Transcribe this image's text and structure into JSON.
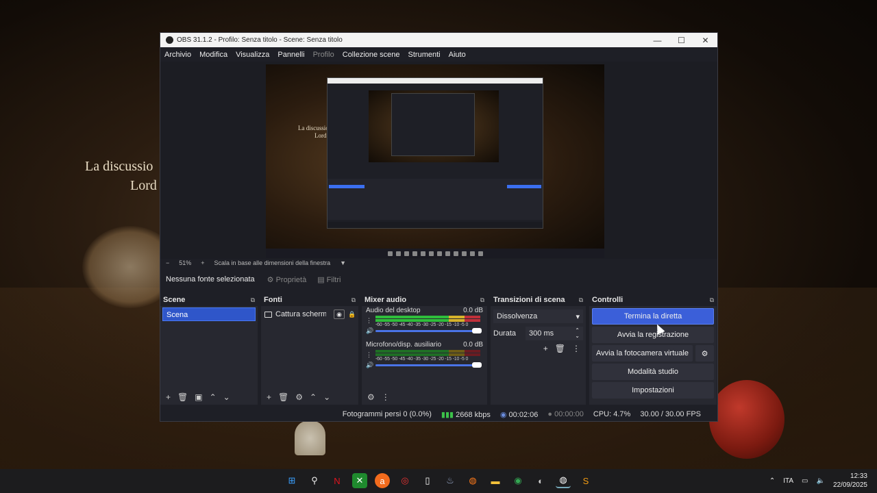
{
  "desktop": {
    "bg_text_line1": "La discussio",
    "bg_text_line2": "Lord"
  },
  "window": {
    "title": "OBS 31.1.2 - Profilo: Senza titolo - Scene: Senza titolo",
    "controls": {
      "minimize": "—",
      "maximize": "☐",
      "close": "✕"
    }
  },
  "menu": {
    "items": [
      "Archivio",
      "Modifica",
      "Visualizza",
      "Pannelli",
      "Profilo",
      "Collezione scene",
      "Strumenti",
      "Aiuto"
    ],
    "disabled_item": "Profilo"
  },
  "preview": {
    "text_line1": "La discussio",
    "text_line2": "Lord"
  },
  "zoombar": {
    "minus": "−",
    "zoom": "51%",
    "plus": "+",
    "mode": "Scala in base alle dimensioni della finestra",
    "dropdown": "▼"
  },
  "sourcebar": {
    "no_selection": "Nessuna fonte selezionata",
    "properties": "Proprietà",
    "filters": "Filtri"
  },
  "scenes": {
    "title": "Scene",
    "items": [
      "Scena"
    ]
  },
  "sources": {
    "title": "Fonti",
    "items": [
      "Cattura schermo"
    ]
  },
  "mixer": {
    "title": "Mixer audio",
    "scale": "-60 -55 -50 -45 -40 -35 -30 -25 -20 -15 -10 -5 0",
    "channels": [
      {
        "name": "Audio del desktop",
        "db": "0.0 dB"
      },
      {
        "name": "Microfono/disp. ausiliario",
        "db": "0.0 dB"
      }
    ]
  },
  "transitions": {
    "title": "Transizioni di scena",
    "selected": "Dissolvenza",
    "duration_label": "Durata",
    "duration_value": "300 ms"
  },
  "controls": {
    "title": "Controlli",
    "stop_stream": "Termina la diretta",
    "start_recording": "Avvia la registrazione",
    "start_virtualcam": "Avvia la fotocamera virtuale",
    "studio_mode": "Modalità studio",
    "settings": "Impostazioni"
  },
  "status": {
    "dropped_frames": "Fotogrammi persi 0 (0.0%)",
    "bitrate": "2668 kbps",
    "live_time": "00:02:06",
    "rec_time": "00:00:00",
    "cpu": "CPU: 4.7%",
    "fps": "30.00 / 30.00 FPS"
  },
  "tray": {
    "language": "ITA",
    "time": "12:33",
    "date": "22/09/2025"
  },
  "colors": {
    "accent": "#3b5fd9",
    "window_bg": "#1e1f26",
    "dock_bg": "#272830",
    "meter_green": "#2fbe3b",
    "meter_yellow": "#d6b22b",
    "meter_red": "#c0303a"
  }
}
